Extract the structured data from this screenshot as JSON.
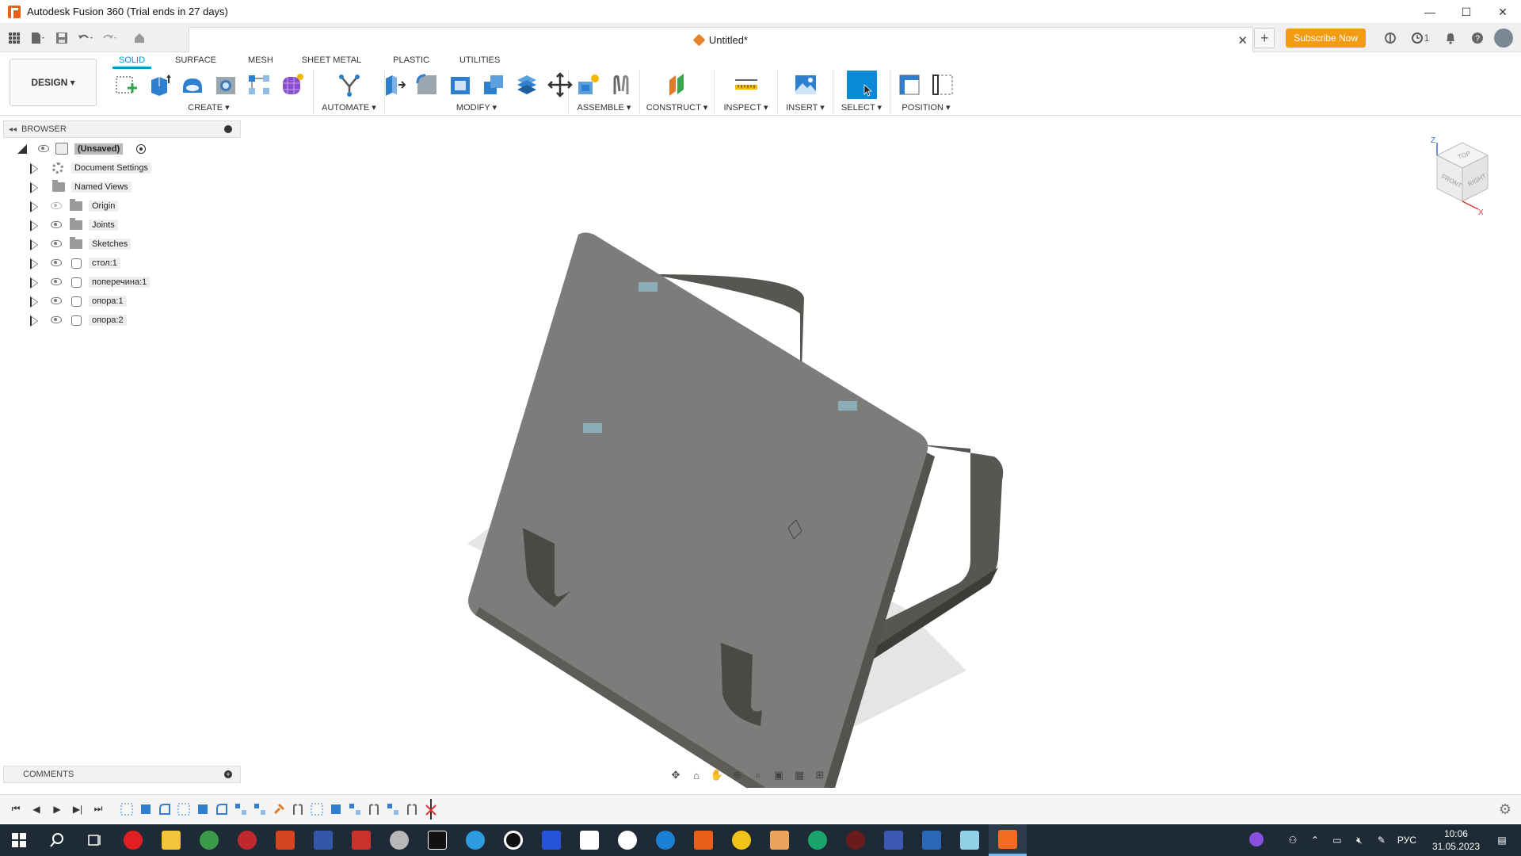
{
  "window": {
    "title": "Autodesk Fusion 360 (Trial ends in 27 days)",
    "minimize": "—",
    "maximize": "☐",
    "close": "✕"
  },
  "quick_access": {
    "doc_tab_title": "Untitled*",
    "subscribe_label": "Subscribe Now",
    "job_count": "1"
  },
  "workspace": {
    "label": "DESIGN ▾"
  },
  "ribbon_tabs": [
    "SOLID",
    "SURFACE",
    "MESH",
    "SHEET METAL",
    "PLASTIC",
    "UTILITIES"
  ],
  "groups": {
    "create": "CREATE ▾",
    "automate": "AUTOMATE ▾",
    "modify": "MODIFY ▾",
    "assemble": "ASSEMBLE ▾",
    "construct": "CONSTRUCT ▾",
    "inspect": "INSPECT ▾",
    "insert": "INSERT ▾",
    "select": "SELECT ▾",
    "position": "POSITION ▾"
  },
  "browser": {
    "title": "BROWSER",
    "root": "(Unsaved)",
    "items": [
      {
        "label": "Document Settings"
      },
      {
        "label": "Named Views"
      },
      {
        "label": "Origin"
      },
      {
        "label": "Joints"
      },
      {
        "label": "Sketches"
      },
      {
        "label": "стол:1"
      },
      {
        "label": "поперечина:1"
      },
      {
        "label": "опора:1"
      },
      {
        "label": "опора:2"
      }
    ]
  },
  "viewcube": {
    "top": "TOP",
    "front": "FRONT",
    "right": "RIGHT",
    "z": "Z",
    "x": "X"
  },
  "comments": {
    "title": "COMMENTS"
  },
  "taskbar": {
    "language": "РУС",
    "time": "10:06",
    "date": "31.05.2023"
  },
  "colors": {
    "accent": "#0696d7",
    "subscribe": "#f39c12",
    "fusion_orange": "#e8601c",
    "model_gray": "#7c7c7a"
  }
}
